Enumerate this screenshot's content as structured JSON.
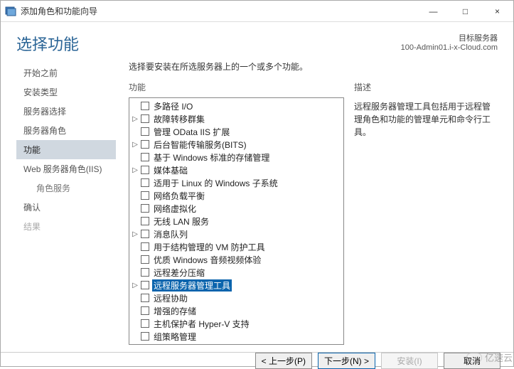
{
  "window": {
    "title": "添加角色和功能向导",
    "minimize": "—",
    "maximize": "□",
    "close": "×"
  },
  "header": {
    "title": "选择功能",
    "target_label": "目标服务器",
    "target_server": "100-Admin01.i-x-Cloud.com"
  },
  "sidebar": {
    "steps": [
      {
        "label": "开始之前",
        "active": false
      },
      {
        "label": "安装类型",
        "active": false
      },
      {
        "label": "服务器选择",
        "active": false
      },
      {
        "label": "服务器角色",
        "active": false
      },
      {
        "label": "功能",
        "active": true
      },
      {
        "label": "Web 服务器角色(IIS)",
        "active": false
      },
      {
        "label": "角色服务",
        "active": false,
        "sub": true
      },
      {
        "label": "确认",
        "active": false
      },
      {
        "label": "结果",
        "active": false,
        "dim": true
      }
    ]
  },
  "main": {
    "intro": "选择要安装在所选服务器上的一个或多个功能。",
    "features_header": "功能",
    "description_header": "描述",
    "description_text": "远程服务器管理工具包括用于远程管理角色和功能的管理单元和命令行工具。",
    "features": [
      {
        "expand": "none",
        "label": "多路径 I/O",
        "selected": false
      },
      {
        "expand": "right",
        "label": "故障转移群集",
        "selected": false
      },
      {
        "expand": "none",
        "label": "管理 OData IIS 扩展",
        "selected": false
      },
      {
        "expand": "right",
        "label": "后台智能传输服务(BITS)",
        "selected": false
      },
      {
        "expand": "none",
        "label": "基于 Windows 标准的存储管理",
        "selected": false
      },
      {
        "expand": "right",
        "label": "媒体基础",
        "selected": false
      },
      {
        "expand": "none",
        "label": "适用于 Linux 的 Windows 子系统",
        "selected": false
      },
      {
        "expand": "none",
        "label": "网络负载平衡",
        "selected": false
      },
      {
        "expand": "none",
        "label": "网络虚拟化",
        "selected": false
      },
      {
        "expand": "none",
        "label": "无线 LAN 服务",
        "selected": false
      },
      {
        "expand": "right",
        "label": "消息队列",
        "selected": false
      },
      {
        "expand": "none",
        "label": "用于结构管理的 VM 防护工具",
        "selected": false
      },
      {
        "expand": "none",
        "label": "优质 Windows 音频视频体验",
        "selected": false
      },
      {
        "expand": "none",
        "label": "远程差分压缩",
        "selected": false
      },
      {
        "expand": "right",
        "label": "远程服务器管理工具",
        "selected": true
      },
      {
        "expand": "none",
        "label": "远程协助",
        "selected": false
      },
      {
        "expand": "none",
        "label": "增强的存储",
        "selected": false
      },
      {
        "expand": "none",
        "label": "主机保护者 Hyper-V 支持",
        "selected": false
      },
      {
        "expand": "none",
        "label": "组策略管理",
        "selected": false
      }
    ]
  },
  "footer": {
    "previous": "< 上一步(P)",
    "next": "下一步(N) >",
    "install": "安装(I)",
    "cancel": "取消"
  },
  "watermark": "亿速云"
}
